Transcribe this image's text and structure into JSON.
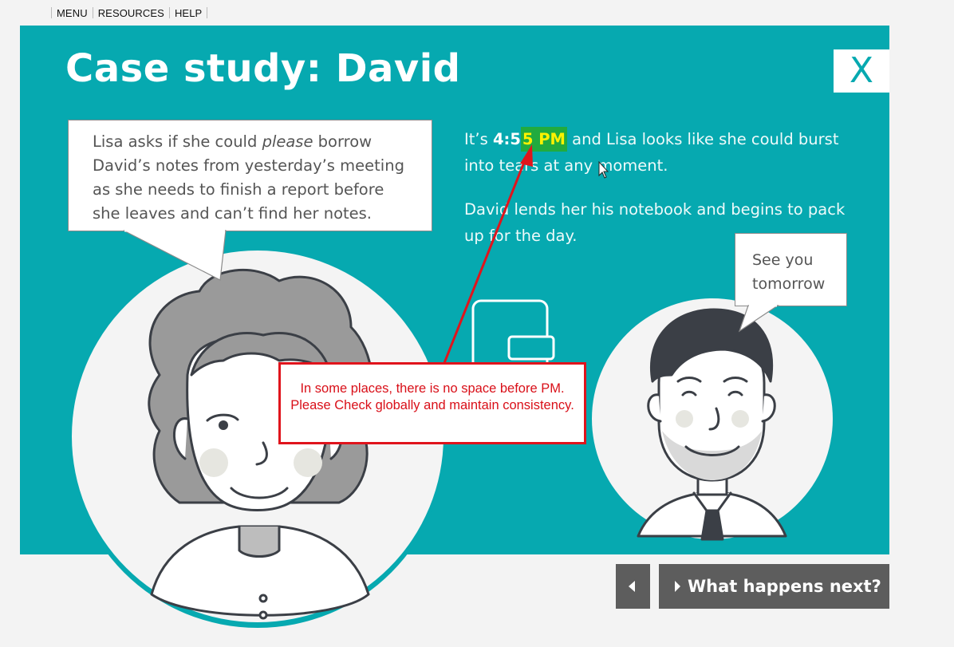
{
  "nav": {
    "items": [
      "MENU",
      "RESOURCES",
      "HELP"
    ]
  },
  "page": {
    "title": "Case study: David",
    "close_label": "X"
  },
  "bubble_lisa": {
    "text_before": "Lisa asks if she could ",
    "emphasis": "please",
    "text_after": " borrow David’s notes from yesterday’s meeting as she needs to finish a report before she leaves and can’t find her notes."
  },
  "narration": {
    "p1_start": "It’s ",
    "p1_time_prefix": "4:5",
    "p1_time_highlight": "5 PM",
    "p1_end": " and Lisa looks like she could burst into tears at any moment.",
    "p2": "David lends her his notebook and begins to pack up for the day."
  },
  "bubble_david": {
    "text": "See you tomorrow"
  },
  "annotation": {
    "text": "In some places, there is no space before PM. Please Check globally and maintain consistency."
  },
  "bottom_nav": {
    "next_label": "What happens next?"
  },
  "colors": {
    "teal": "#06a9b0",
    "highlight_bg": "#21ab3f",
    "highlight_text": "#fff200",
    "annotation_red": "#e0141c",
    "button_gray": "#5d5d5d"
  }
}
